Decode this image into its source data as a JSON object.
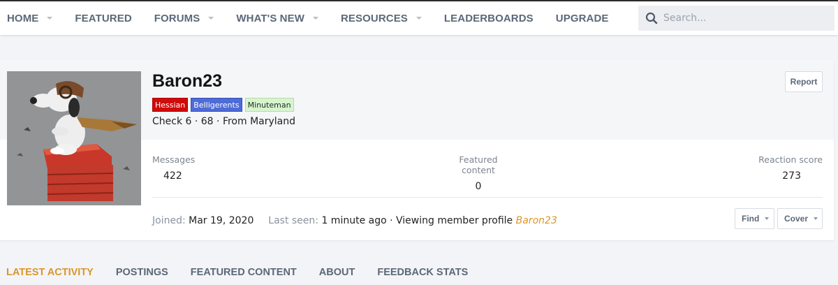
{
  "nav": {
    "items": [
      {
        "label": "HOME",
        "has_dropdown": true
      },
      {
        "label": "FEATURED",
        "has_dropdown": false
      },
      {
        "label": "FORUMS",
        "has_dropdown": true
      },
      {
        "label": "WHAT'S NEW",
        "has_dropdown": true
      },
      {
        "label": "RESOURCES",
        "has_dropdown": true
      },
      {
        "label": "LEADERBOARDS",
        "has_dropdown": false
      },
      {
        "label": "UPGRADE",
        "has_dropdown": false
      }
    ],
    "search": {
      "placeholder": "Search...",
      "icon": "search-icon"
    }
  },
  "profile": {
    "username": "Baron23",
    "avatar_icon": "avatar-snoopy-flying-ace",
    "badges": [
      {
        "label": "Hessian",
        "color": "#d10a0a"
      },
      {
        "label": "Belligerents",
        "color": "#4e6bd6"
      },
      {
        "label": "Minuteman",
        "color": "#d7f4cf"
      }
    ],
    "subline": "Check 6 · 68 · From Maryland",
    "report_label": "Report",
    "stats": {
      "messages_label": "Messages",
      "messages_value": "422",
      "featured_label": "Featured content",
      "featured_value": "0",
      "reaction_label": "Reaction score",
      "reaction_value": "273"
    },
    "joined_label": "Joined:",
    "joined_value": "Mar 19, 2020",
    "last_seen_label": "Last seen:",
    "last_seen_value": "1 minute ago · Viewing member profile",
    "last_seen_link": "Baron23",
    "find_label": "Find",
    "cover_label": "Cover"
  },
  "tabs": [
    {
      "label": "LATEST ACTIVITY",
      "active": true
    },
    {
      "label": "POSTINGS",
      "active": false
    },
    {
      "label": "FEATURED CONTENT",
      "active": false
    },
    {
      "label": "ABOUT",
      "active": false
    },
    {
      "label": "FEEDBACK STATS",
      "active": false
    }
  ],
  "colors": {
    "accent": "#d9962b",
    "nav_text": "#5b6878",
    "muted": "#8a939e"
  }
}
